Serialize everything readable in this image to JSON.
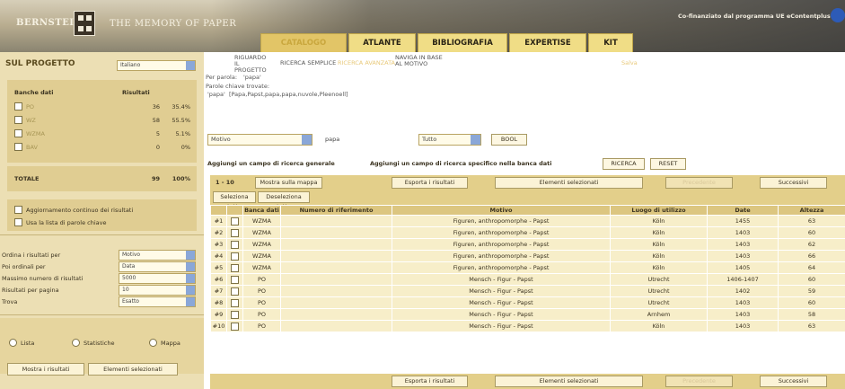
{
  "header": {
    "logo_left": "BERNSTEIN",
    "logo_tagline": "THE MEMORY OF PAPER",
    "cofinance_text": "Co-finanziato dal programma UE eContentplus",
    "tabs": [
      "CATALOGO",
      "ATLANTE",
      "BIBLIOGRAFIA",
      "EXPERTISE",
      "KIT"
    ],
    "active_tab": "CATALOGO",
    "colors": {
      "tab": "#f0dd86",
      "tab_active_text": "#c9a73e"
    }
  },
  "sidebar": {
    "title": "SUL PROGETTO",
    "language_select": "Italiano",
    "banks_header": "Banche dati",
    "results_header": "Risultati",
    "banks": [
      {
        "name": "PO",
        "count": "36",
        "percent": "35.4%"
      },
      {
        "name": "WZ",
        "count": "58",
        "percent": "55.5%"
      },
      {
        "name": "WZMA",
        "count": "5",
        "percent": "5.1%"
      },
      {
        "name": "BAV",
        "count": "0",
        "percent": "0%"
      }
    ],
    "total_label": "TOTALE",
    "total_count": "99",
    "total_percent": "100%",
    "options": [
      "Aggiornamento continuo dei risultati",
      "Usa la lista di parole chiave"
    ],
    "settings": [
      {
        "label": "Ordina i risultati per",
        "value": "Motivo"
      },
      {
        "label": "Poi ordinali per",
        "value": "Data"
      },
      {
        "label": "Massimo numero di risultati",
        "value": "5000"
      },
      {
        "label": "Risultati per pagina",
        "value": "10"
      },
      {
        "label": "Trova",
        "value": "Esatto"
      }
    ],
    "view_modes": [
      "Lista",
      "Statistiche",
      "Mappa"
    ],
    "buttons": [
      "Mostra i risultati",
      "Elementi selezionati"
    ]
  },
  "main": {
    "subnav": [
      "RIGUARDO IL PROGETTO",
      "RICERCA SEMPLICE",
      "RICERCA AVANZATA",
      "NAVIGA IN BASE AL MOTIVO"
    ],
    "subnav_extra": "Salva",
    "search_term_label": "Per parola:",
    "search_term_value": "'papa'",
    "keywords_label": "Parole chiave trovate:",
    "keywords_term": "'papa'",
    "keywords_value": "[Papa,Papst,papa,papa,nuvole,Pleenoell]",
    "filter_field": "Motivo",
    "filter_value": "papa",
    "filter_scope": "Tutto",
    "filter_button": "BOOL",
    "add_general": "Aggiungi un campo di ricerca generale",
    "add_specific": "Aggiungi un campo di ricerca specifico nella banca dati",
    "search_button": "RICERCA",
    "reset_button": "RESET",
    "range": "1 - 10",
    "toolbar": {
      "map": "Mostra sulla mappa",
      "export": "Esporta i risultati",
      "selected": "Elementi selezionati",
      "prev": "Precedente",
      "next": "Successivi",
      "select_all": "Seleziona tutto",
      "deselect_all": "Deseleziona tutto"
    },
    "columns": [
      "",
      "",
      "Banca dati",
      "Numero di riferimento",
      "Motivo",
      "Luogo di utilizzo",
      "Date",
      "Altezza"
    ],
    "rows": [
      {
        "n": "#1",
        "db": "WZMA",
        "ref": "",
        "motif": "Figuren, anthropomorphe - Papst",
        "place": "Köln",
        "date": "1455",
        "height": "63"
      },
      {
        "n": "#2",
        "db": "WZMA",
        "ref": "",
        "motif": "Figuren, anthropomorphe - Papst",
        "place": "Köln",
        "date": "1403",
        "height": "60"
      },
      {
        "n": "#3",
        "db": "WZMA",
        "ref": "",
        "motif": "Figuren, anthropomorphe - Papst",
        "place": "Köln",
        "date": "1403",
        "height": "62"
      },
      {
        "n": "#4",
        "db": "WZMA",
        "ref": "",
        "motif": "Figuren, anthropomorphe - Papst",
        "place": "Köln",
        "date": "1403",
        "height": "66"
      },
      {
        "n": "#5",
        "db": "WZMA",
        "ref": "",
        "motif": "Figuren, anthropomorphe - Papst",
        "place": "Köln",
        "date": "1405",
        "height": "64"
      },
      {
        "n": "#6",
        "db": "PO",
        "ref": "",
        "motif": "Mensch - Figur - Papst",
        "place": "Utrecht",
        "date": "1406-1407",
        "height": "60"
      },
      {
        "n": "#7",
        "db": "PO",
        "ref": "",
        "motif": "Mensch - Figur - Papst",
        "place": "Utrecht",
        "date": "1402",
        "height": "59"
      },
      {
        "n": "#8",
        "db": "PO",
        "ref": "",
        "motif": "Mensch - Figur - Papst",
        "place": "Utrecht",
        "date": "1403",
        "height": "60"
      },
      {
        "n": "#9",
        "db": "PO",
        "ref": "",
        "motif": "Mensch - Figur - Papst",
        "place": "Arnhem",
        "date": "1403",
        "height": "58"
      },
      {
        "n": "#10",
        "db": "PO",
        "ref": "",
        "motif": "Mensch - Figur - Papst",
        "place": "Köln",
        "date": "1403",
        "height": "63"
      }
    ]
  }
}
